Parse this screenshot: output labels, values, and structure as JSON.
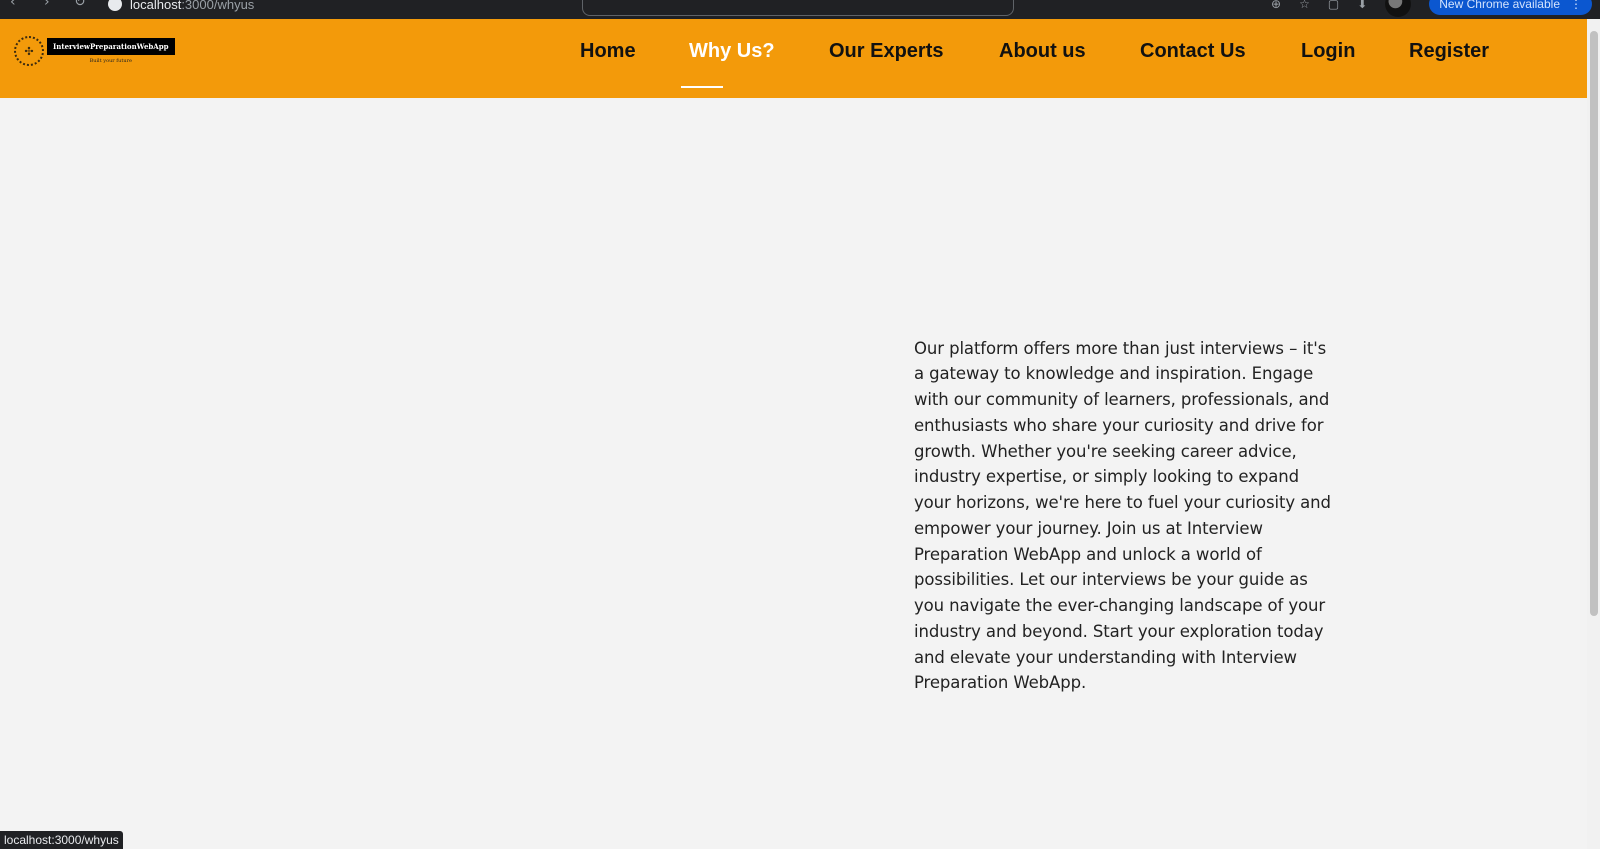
{
  "browser": {
    "url_host": "localhost",
    "url_path": ":3000/whyus",
    "update_button_label": "New Chrome available",
    "status_url": "localhost:3000/whyus"
  },
  "header": {
    "logo_title": "InterviewPreparationWebApp",
    "logo_tagline": "Built your future"
  },
  "nav": {
    "items": [
      {
        "label": "Home"
      },
      {
        "label": "Why Us?",
        "active": true
      },
      {
        "label": "Our Experts"
      },
      {
        "label": "About us"
      },
      {
        "label": "Contact Us"
      },
      {
        "label": "Login"
      },
      {
        "label": "Register"
      }
    ]
  },
  "main": {
    "paragraph": "Our platform offers more than just interviews – it's a gateway to knowledge and inspiration. Engage with our community of learners, professionals, and enthusiasts who share your curiosity and drive for growth. Whether you're seeking career advice, industry expertise, or simply looking to expand your horizons, we're here to fuel your curiosity and empower your journey. Join us at Interview Preparation WebApp and unlock a world of possibilities. Let our interviews be your guide as you navigate the ever-changing landscape of your industry and beyond. Start your exploration today and elevate your understanding with Interview Preparation WebApp."
  },
  "colors": {
    "header_bg": "#f39a0a",
    "page_bg": "#f3f3f3",
    "active_nav": "#ffffff"
  }
}
